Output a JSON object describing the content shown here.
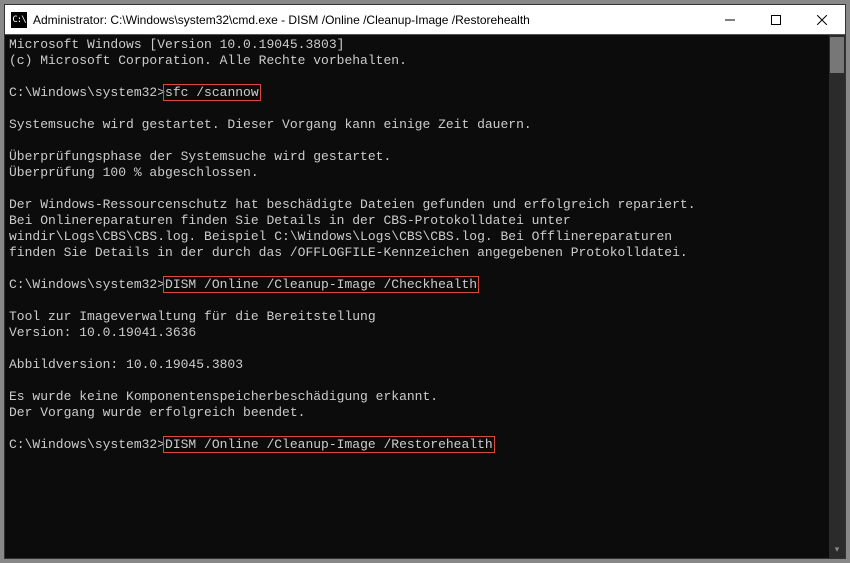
{
  "titlebar": {
    "icon_text": "C:\\",
    "title": "Administrator: C:\\Windows\\system32\\cmd.exe - DISM  /Online /Cleanup-Image /Restorehealth"
  },
  "terminal": {
    "version_line": "Microsoft Windows [Version 10.0.19045.3803]",
    "copyright_line": "(c) Microsoft Corporation. Alle Rechte vorbehalten.",
    "prompt1": "C:\\Windows\\system32>",
    "cmd1": "sfc /scannow",
    "sys_start": "Systemsuche wird gestartet. Dieser Vorgang kann einige Zeit dauern.",
    "phase1": "Überprüfungsphase der Systemsuche wird gestartet.",
    "phase2": "Überprüfung 100 % abgeschlossen.",
    "result1": "Der Windows-Ressourcenschutz hat beschädigte Dateien gefunden und erfolgreich repariert.",
    "result2": "Bei Onlinereparaturen finden Sie Details in der CBS-Protokolldatei unter",
    "result3": "windir\\Logs\\CBS\\CBS.log. Beispiel C:\\Windows\\Logs\\CBS\\CBS.log. Bei Offlinereparaturen",
    "result4": "finden Sie Details in der durch das /OFFLOGFILE-Kennzeichen angegebenen Protokolldatei.",
    "prompt2": "C:\\Windows\\system32>",
    "cmd2": "DISM /Online /Cleanup-Image /Checkhealth",
    "dism_tool": "Tool zur Imageverwaltung für die Bereitstellung",
    "dism_version": "Version: 10.0.19041.3636",
    "image_version": "Abbildversion: 10.0.19045.3803",
    "dism_result1": "Es wurde keine Komponentenspeicherbeschädigung erkannt.",
    "dism_result2": "Der Vorgang wurde erfolgreich beendet.",
    "prompt3": "C:\\Windows\\system32>",
    "cmd3": "DISM /Online /Cleanup-Image /Restorehealth"
  },
  "colors": {
    "highlight_border": "#d84a3e"
  }
}
